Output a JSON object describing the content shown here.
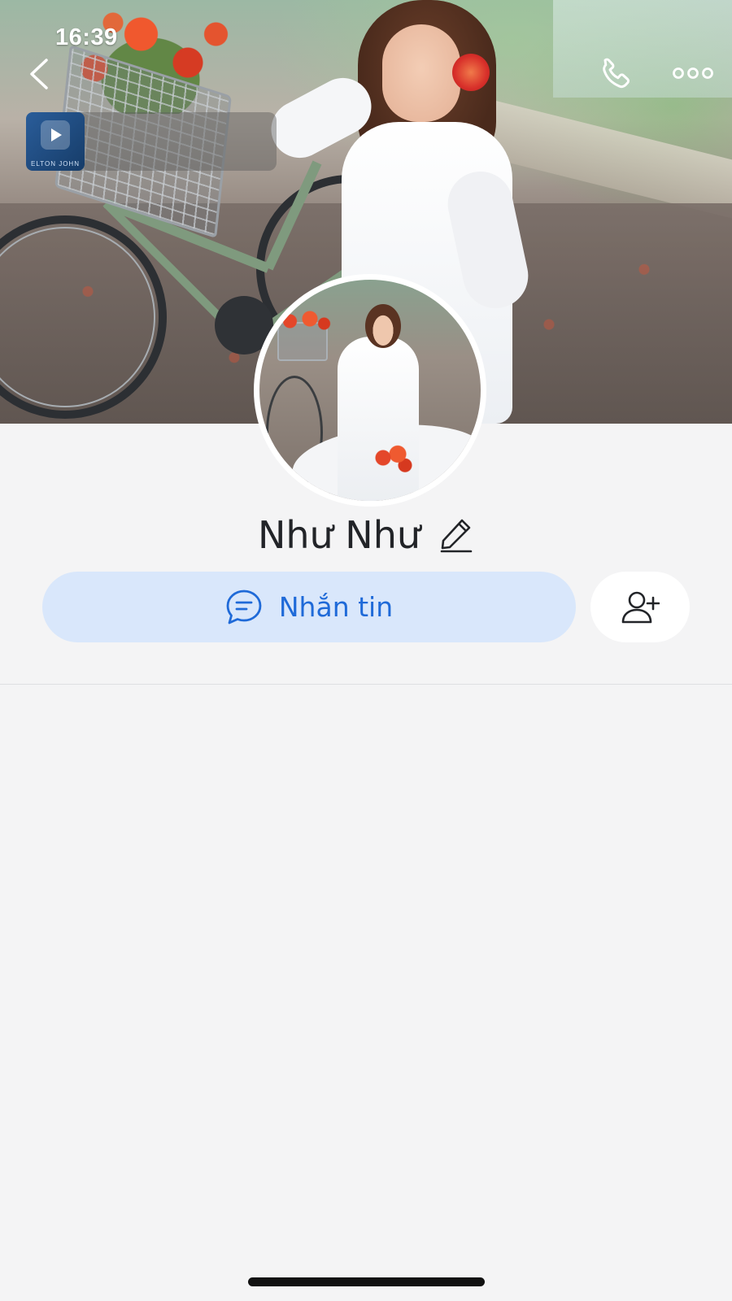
{
  "status_bar": {
    "time": "16:39"
  },
  "header": {
    "back_icon": "chevron-left-icon",
    "call_icon": "phone-icon",
    "more_icon": "ellipsis-icon"
  },
  "music_widget": {
    "caption": "ELTON JOHN",
    "icon": "play-icon"
  },
  "profile": {
    "name": "Như Như",
    "edit_icon": "pencil-icon"
  },
  "actions": {
    "message_label": "Nhắn tin",
    "message_icon": "chat-bubble-icon",
    "add_friend_icon": "add-user-icon"
  },
  "colors": {
    "accent": "#1f6ad8",
    "message_button_bg": "#d9e7fb",
    "page_bg": "#f4f4f5"
  }
}
